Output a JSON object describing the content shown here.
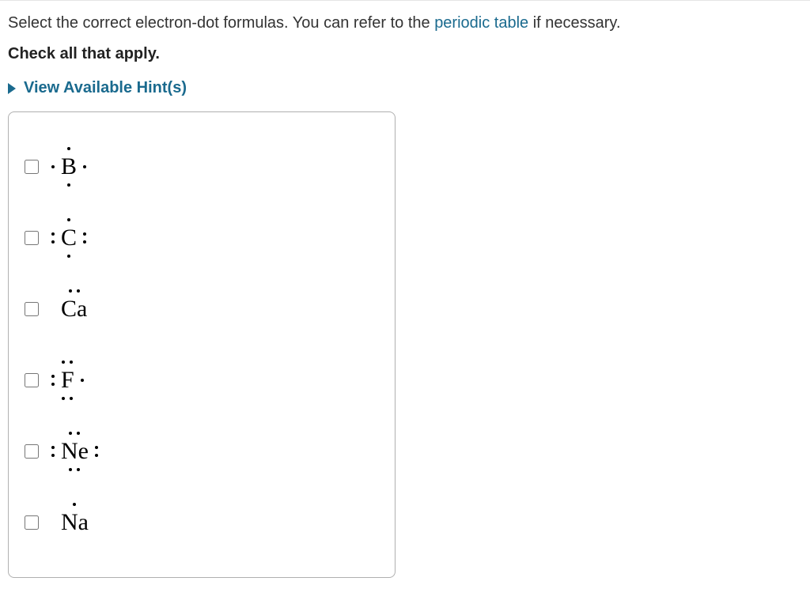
{
  "instruction": {
    "prefix": "Select the correct electron-dot formulas. You can refer to the ",
    "link_text": "periodic table",
    "suffix": " if necessary."
  },
  "check_label": "Check all that apply.",
  "hints_label": "View Available Hint(s)",
  "options": [
    {
      "symbol": "B",
      "top": "single",
      "bottom": "single",
      "left": "single",
      "right": "single"
    },
    {
      "symbol": "C",
      "top": "single",
      "bottom": "single",
      "left": "pair",
      "right": "pair"
    },
    {
      "symbol": "Ca",
      "top": "pair",
      "bottom": "none",
      "left": "none",
      "right": "none"
    },
    {
      "symbol": "F",
      "top": "pair",
      "bottom": "pair",
      "left": "pair",
      "right": "single"
    },
    {
      "symbol": "Ne",
      "top": "pair",
      "bottom": "pair",
      "left": "pair",
      "right": "pair"
    },
    {
      "symbol": "Na",
      "top": "single",
      "bottom": "none",
      "left": "none",
      "right": "none"
    }
  ]
}
